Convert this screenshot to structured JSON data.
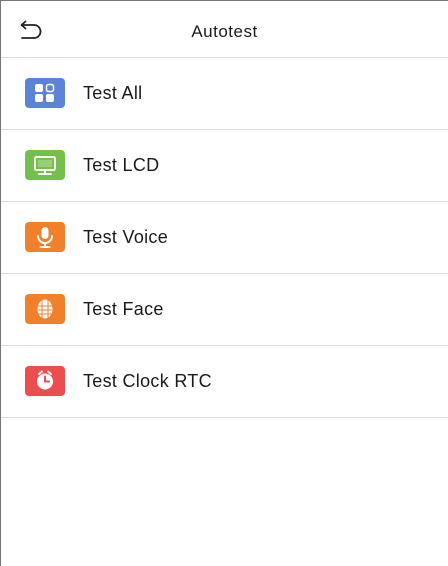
{
  "header": {
    "title": "Autotest",
    "back_icon": "back-arrow-icon"
  },
  "items": [
    {
      "label": "Test All",
      "icon": "test-all-icon",
      "color": "#5b84d6"
    },
    {
      "label": "Test LCD",
      "icon": "monitor-icon",
      "color": "#74c04b"
    },
    {
      "label": "Test Voice",
      "icon": "microphone-icon",
      "color": "#f0802a"
    },
    {
      "label": "Test Face",
      "icon": "face-icon",
      "color": "#f0802a"
    },
    {
      "label": "Test Clock RTC",
      "icon": "clock-icon",
      "color": "#ec4d4d"
    }
  ]
}
